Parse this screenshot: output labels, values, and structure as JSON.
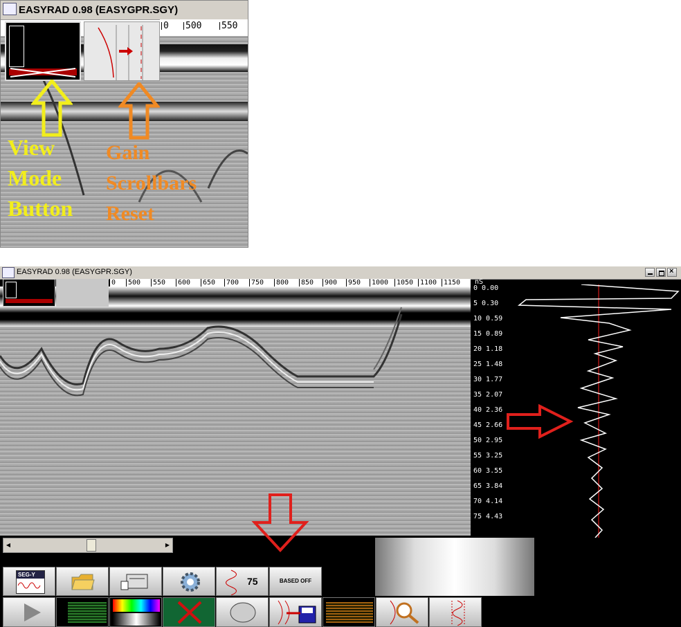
{
  "window": {
    "title": "EASYRAD 0.98 (EASYGPR.SGY)"
  },
  "top_panel": {
    "scale_labels": [
      "0",
      "500",
      "550"
    ],
    "callout_view": [
      "View",
      "Mode",
      "Button"
    ],
    "callout_gain": [
      "Gain",
      "Scrollbars",
      "Reset"
    ]
  },
  "main_window": {
    "scale_labels": [
      "0",
      "500",
      "550",
      "600",
      "650",
      "700",
      "750",
      "800",
      "850",
      "900",
      "950",
      "1000",
      "1050",
      "1100",
      "1150"
    ],
    "unit_label": "nS",
    "depth_labels": [
      "0 0.00",
      "5 0.30",
      "10 0.59",
      "15 0.89",
      "20 1.18",
      "25 1.48",
      "30 1.77",
      "35 2.07",
      "40 2.36",
      "45 2.66",
      "50 2.95",
      "55 3.25",
      "60 3.55",
      "65 3.84",
      "70 4.14",
      "75 4.43"
    ],
    "toolbar": {
      "segy_label": "SEG-Y",
      "gain_value": "75",
      "based_label": "BASED OFF"
    }
  },
  "colors": {
    "callout_yellow": "#f2ee1c",
    "callout_orange": "#f08a24",
    "arrow_red": "#e0201c",
    "trace_red": "#ff2020"
  },
  "icons": [
    "app-icon",
    "segy-icon",
    "folder-icon",
    "printer-icon",
    "gear-icon",
    "wave-icon",
    "play-icon",
    "color-palette-icon",
    "cross-icon",
    "ellipse-icon",
    "save-icon",
    "zoom-icon",
    "trace-icon",
    "minimize-icon",
    "maximize-icon",
    "close-icon"
  ]
}
